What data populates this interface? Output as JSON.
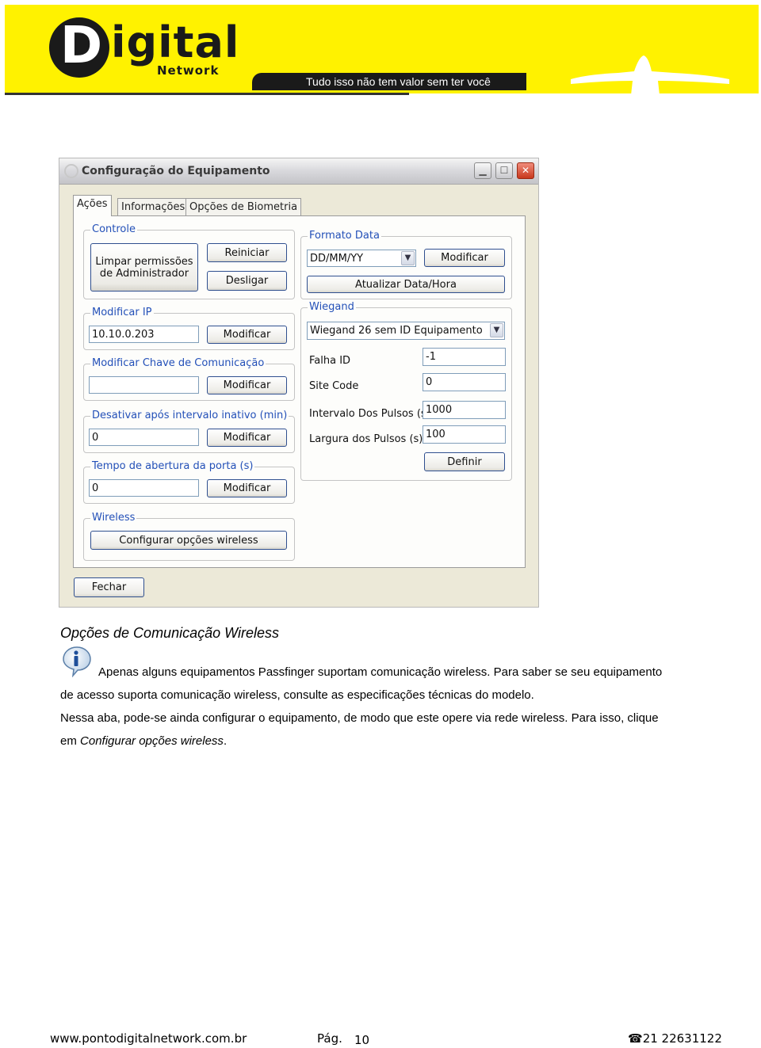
{
  "header": {
    "logo_letter": "D",
    "logo_rest": "igital",
    "logo_sub": "Network",
    "slogan": "Tudo isso não tem valor sem ter você",
    "brand_color": "#fff200"
  },
  "window": {
    "title": "Configuração do Equipamento",
    "minimize_glyph": "▁",
    "maximize_glyph": "☐",
    "close_glyph": "✕",
    "tabs": [
      "Ações",
      "Informações",
      "Opções de Biometria"
    ],
    "controle": {
      "label": "Controle",
      "limpar_button": "Limpar permissões de Administrador",
      "reiniciar_button": "Reiniciar",
      "desligar_button": "Desligar"
    },
    "modificar_ip": {
      "label": "Modificar IP",
      "value": "10.10.0.203",
      "button": "Modificar"
    },
    "chave": {
      "label": "Modificar Chave de Comunicação",
      "value": "",
      "button": "Modificar"
    },
    "desativar": {
      "label": "Desativar após intervalo inativo (min)",
      "value": "0",
      "button": "Modificar"
    },
    "tempo": {
      "label": "Tempo de abertura da porta (s)",
      "value": "0",
      "button": "Modificar"
    },
    "wireless": {
      "label": "Wireless",
      "button": "Configurar opções wireless"
    },
    "formato_data": {
      "label": "Formato Data",
      "selected": "DD/MM/YY",
      "modificar_button": "Modificar",
      "atualizar_button": "Atualizar Data/Hora"
    },
    "wiegand": {
      "label": "Wiegand",
      "selected": "Wiegand 26 sem ID Equipamento",
      "falha_id_label": "Falha ID",
      "falha_id_value": "-1",
      "site_code_label": "Site Code",
      "site_code_value": "0",
      "intervalo_label": "Intervalo Dos Pulsos (s)",
      "intervalo_value": "1000",
      "largura_label": "Largura dos Pulsos (s)",
      "largura_value": "100",
      "definir_button": "Definir"
    },
    "fechar_button": "Fechar"
  },
  "document": {
    "heading": "Opções de Comunicação Wireless",
    "info_icon": "info-icon",
    "line1": "Apenas alguns equipamentos Passfinger suportam comunicação wireless. Para saber se seu equipamento",
    "line2": "de acesso suporta comunicação wireless, consulte as especificações técnicas do modelo.",
    "line3": "Nessa aba, pode-se ainda configurar o equipamento, de modo que este opere via rede wireless. Para isso, clique",
    "line4_prefix": "em ",
    "line4_italic": "Configurar opções wireless",
    "line4_suffix": "."
  },
  "footer": {
    "website": "www.pontodigitalnetwork.com.br",
    "page_label": "Pág.",
    "page_number": "10",
    "phone_icon": "☎",
    "phone": "21 22631122"
  }
}
